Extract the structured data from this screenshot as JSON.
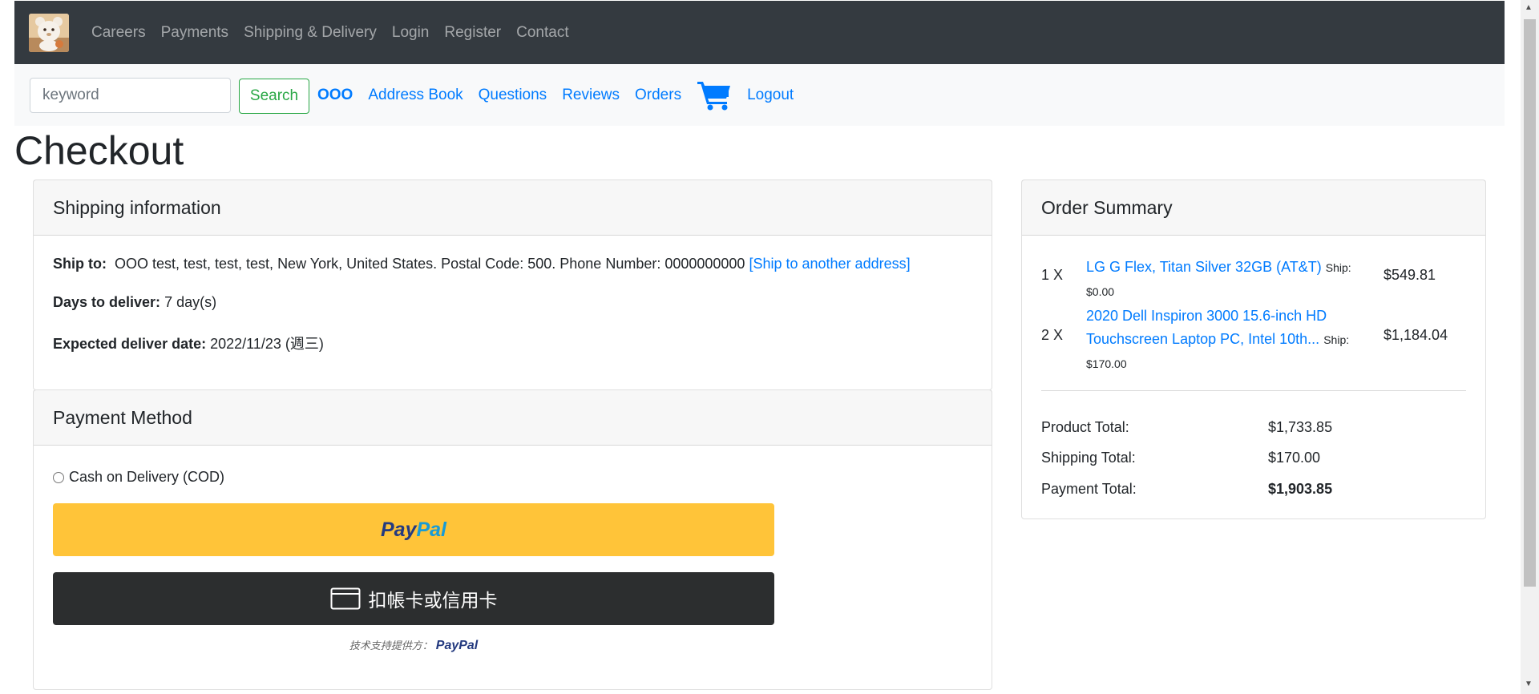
{
  "topnav": {
    "logo_alt": "bear logo",
    "links": [
      "Careers",
      "Payments",
      "Shipping & Delivery",
      "Login",
      "Register",
      "Contact"
    ]
  },
  "subnav": {
    "search_placeholder": "keyword",
    "search_button": "Search",
    "user_name": "OOO",
    "links": [
      "Address Book",
      "Questions",
      "Reviews",
      "Orders"
    ],
    "cart_icon": "shopping-cart-icon",
    "logout": "Logout"
  },
  "page": {
    "title": "Checkout"
  },
  "shipping": {
    "header": "Shipping information",
    "ship_to_label": "Ship to:",
    "ship_to_value": "OOO test, test, test, test, New York, United States. Postal Code: 500. Phone Number: 0000000000",
    "ship_another": "[Ship to another address]",
    "days_label": "Days to deliver:",
    "days_value": "7 day(s)",
    "date_label": "Expected deliver date:",
    "date_value": "2022/11/23 (週三)"
  },
  "payment": {
    "header": "Payment Method",
    "cod_label": "Cash on Delivery (COD)",
    "paypal_part1": "Pay",
    "paypal_part2": "Pal",
    "card_button": "扣帳卡或信用卡",
    "powered_by": "技术支持提供方：",
    "powered_brand": "PayPal"
  },
  "summary": {
    "header": "Order Summary",
    "items": [
      {
        "qty": "1 X",
        "name": "LG G Flex, Titan Silver 32GB (AT&T)",
        "ship": "Ship: $0.00",
        "price": "$549.81"
      },
      {
        "qty": "2 X",
        "name": "2020 Dell Inspiron 3000 15.6-inch HD Touchscreen Laptop PC, Intel 10th...",
        "ship": "Ship: $170.00",
        "price": "$1,184.04"
      }
    ],
    "product_total_label": "Product Total:",
    "product_total": "$1,733.85",
    "shipping_total_label": "Shipping Total:",
    "shipping_total": "$170.00",
    "payment_total_label": "Payment Total:",
    "payment_total": "$1,903.85"
  },
  "colors": {
    "navbar": "#343a40",
    "link": "#007bff",
    "search_green": "#28a745",
    "paypal_yellow": "#ffc439",
    "card_dark": "#2c2e2f"
  }
}
